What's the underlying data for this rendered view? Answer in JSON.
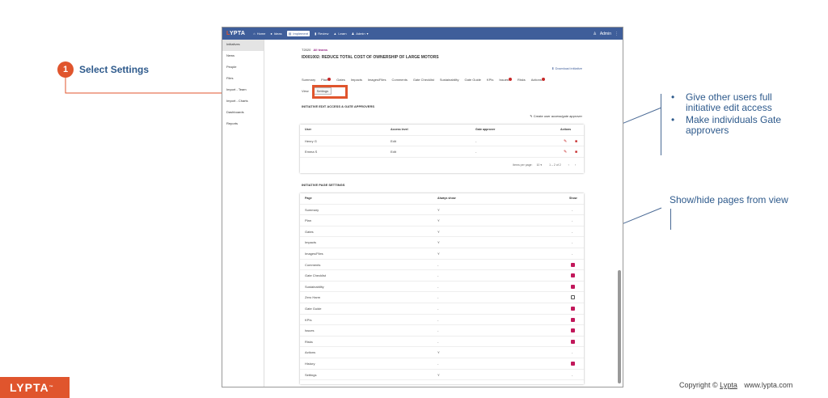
{
  "callout": {
    "step": "1",
    "label": "Select Settings"
  },
  "app": {
    "logo": "LYPTA",
    "nav": [
      "Home",
      "Ideas",
      "Implement",
      "Review",
      "Learn",
      "Admin"
    ],
    "user": "Admin",
    "sidebar": [
      "Initiatives",
      "News",
      "People",
      "Files",
      "Import - Team",
      "Import - Charts",
      "Dashboards",
      "Reports"
    ],
    "breadcrumb": "T2020",
    "team_link": "All teams",
    "initiative_title": "ID001002: REDUCE TOTAL COST OF OWNERSHIP OF LARGE MOTORS",
    "download": "Download initiative",
    "tabs": [
      "Summary",
      "Plan",
      "Gates",
      "Impacts",
      "Images/Files",
      "Comments",
      "Gate Checklist",
      "Sustainability",
      "Gate Guide",
      "KPIs",
      "Issues",
      "Risks",
      "Actions"
    ],
    "subtabs": [
      "View",
      "Settings"
    ],
    "access_section": {
      "title": "INITIATIVE EDIT ACCESS & GATE APPROVERS",
      "create_link": "Create user access/gate approver",
      "headers": [
        "User",
        "Access level",
        "Gate approver",
        "Actions"
      ],
      "rows": [
        {
          "user": "Henry G",
          "access": "Edit",
          "approver": "-"
        },
        {
          "user": "Emma S",
          "access": "Edit",
          "approver": "-"
        }
      ],
      "pager_label": "Items per page:",
      "pager_size": "10",
      "pager_range": "1 – 2 of 2"
    },
    "page_section": {
      "title": "INITIATIVE PAGE SETTINGS",
      "headers": [
        "Page",
        "Always show",
        "Show"
      ],
      "rows": [
        {
          "page": "Summary",
          "always": "Y",
          "show": "-"
        },
        {
          "page": "Plan",
          "always": "Y",
          "show": "-"
        },
        {
          "page": "Gates",
          "always": "Y",
          "show": "-"
        },
        {
          "page": "Impacts",
          "always": "Y",
          "show": "-"
        },
        {
          "page": "Images/Files",
          "always": "Y",
          "show": "-"
        },
        {
          "page": "Comments",
          "always": "-",
          "show": "on"
        },
        {
          "page": "Gate Checklist",
          "always": "-",
          "show": "on"
        },
        {
          "page": "Sustainability",
          "always": "-",
          "show": "on"
        },
        {
          "page": "Zero Harm",
          "always": "-",
          "show": "off"
        },
        {
          "page": "Gate Guide",
          "always": "-",
          "show": "on"
        },
        {
          "page": "KPIs",
          "always": "-",
          "show": "on"
        },
        {
          "page": "Issues",
          "always": "-",
          "show": "on"
        },
        {
          "page": "Risks",
          "always": "-",
          "show": "on"
        },
        {
          "page": "Actions",
          "always": "Y",
          "show": "-"
        },
        {
          "page": "History",
          "always": "-",
          "show": "on"
        },
        {
          "page": "Settings",
          "always": "Y",
          "show": "-"
        }
      ]
    }
  },
  "annotations": {
    "bullets": [
      "Give other users full initiative edit access",
      "Make individuals Gate approvers"
    ],
    "note": "Show/hide pages from view"
  },
  "footer": {
    "logo": "LYPTA",
    "tm": "™",
    "copyright_prefix": "Copyright ©",
    "company": "Lypta",
    "website": "www.lypta.com"
  },
  "colors": {
    "accent": "#e0552d",
    "brand_blue": "#3f5e9a",
    "text_blue": "#2e5a8c",
    "checkbox": "#c2185b"
  }
}
